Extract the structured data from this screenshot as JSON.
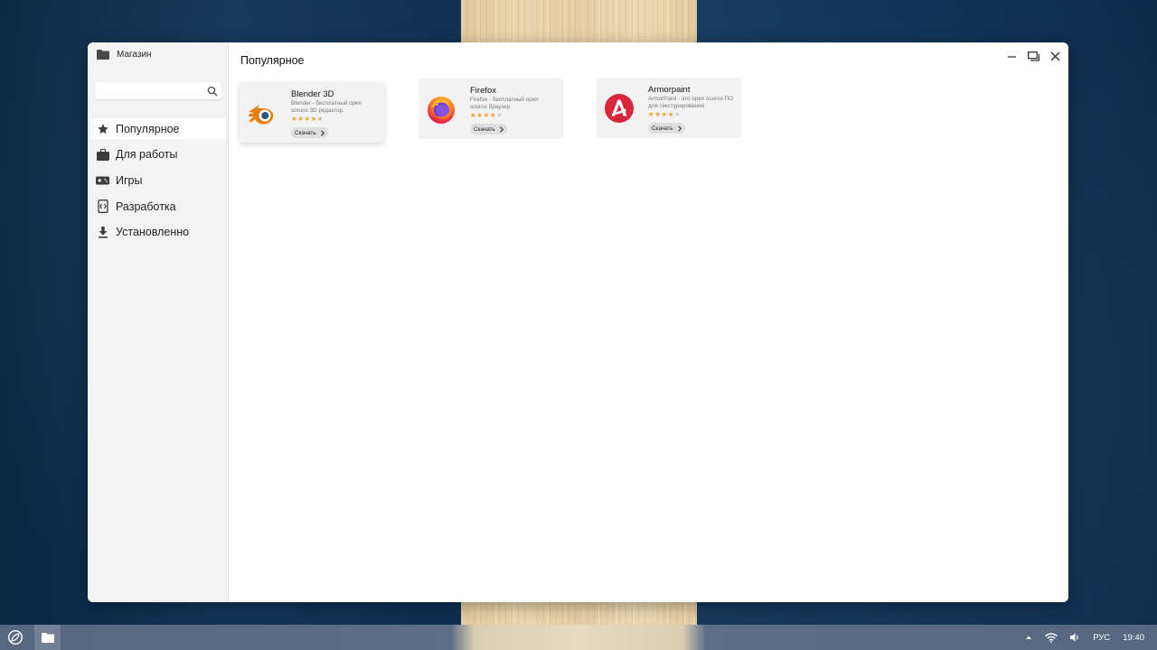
{
  "window": {
    "title": "Магазин",
    "controls": {
      "minimize_icon": "minimize-icon",
      "restore_icon": "restore-icon",
      "close_icon": "close-icon"
    }
  },
  "sidebar": {
    "search": {
      "value": "",
      "placeholder": "",
      "icon": "search-icon"
    },
    "items": [
      {
        "label": "Популярное",
        "icon": "star-icon",
        "active": true
      },
      {
        "label": "Для работы",
        "icon": "briefcase-icon",
        "active": false
      },
      {
        "label": "Игры",
        "icon": "gamepad-icon",
        "active": false
      },
      {
        "label": "Разработка",
        "icon": "developer-icon",
        "active": false
      },
      {
        "label": "Установленно",
        "icon": "download-icon",
        "active": false
      }
    ]
  },
  "main": {
    "title": "Популярное",
    "apps": [
      {
        "name": "Blender 3D",
        "description": "Blender - бесплатный open soruce 3D редактор.",
        "rating": 4.5,
        "button_label": "Скачать",
        "icon": "blender-icon"
      },
      {
        "name": "Firefox",
        "description": "Firefox - бесплатный open source браузер.",
        "rating": 4,
        "button_label": "Скачать",
        "icon": "firefox-icon"
      },
      {
        "name": "Armorpaint",
        "description": "ArmorPaint - это open source ПО для текстурирования",
        "rating": 4,
        "button_label": "Скачать",
        "icon": "armorpaint-icon"
      }
    ]
  },
  "taskbar": {
    "start_icon": "start-menu-icon",
    "pinned": [
      {
        "icon": "folder-icon"
      }
    ],
    "tray": {
      "language": "РУС",
      "time": "19:40"
    }
  },
  "colors": {
    "accent_star": "#f2a12b",
    "blender_orange": "#e87d0d",
    "armorpaint_red": "#d9263b",
    "sidebar_bg": "#f3f3f3",
    "card_bg": "#f2f2f2"
  }
}
